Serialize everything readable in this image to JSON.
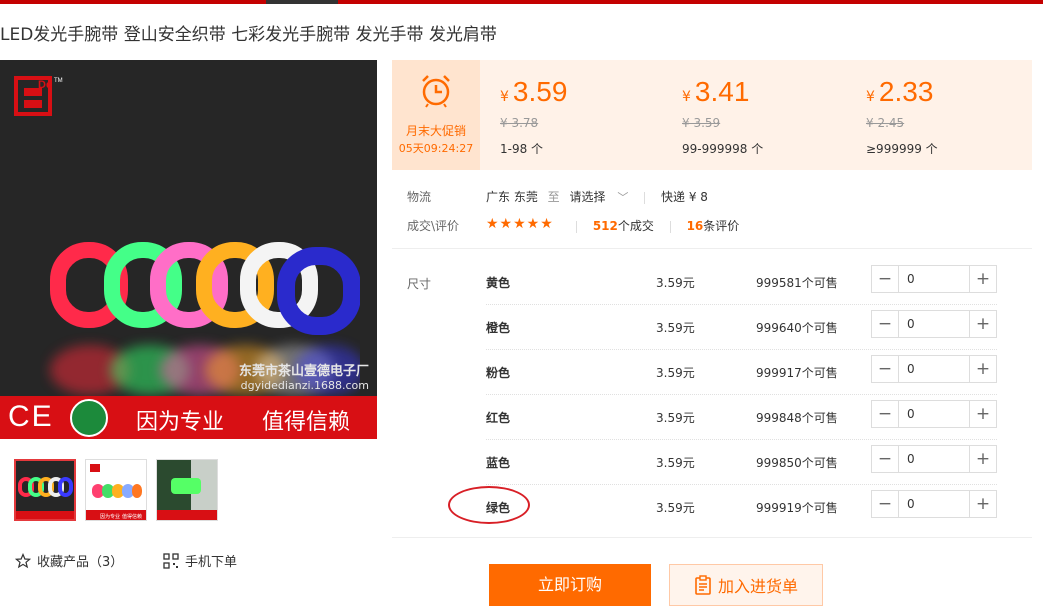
{
  "product": {
    "title": "LED发光手腕带 登山安全织带 七彩发光手腕带 发光手带 发光肩带"
  },
  "image": {
    "watermark_company": "东莞市茶山壹德电子厂",
    "watermark_url": "dgyidedianzi.1688.com",
    "ce_mark": "CE",
    "slogan_1": "因为专业",
    "slogan_2": "值得信赖",
    "logo_text": "De",
    "logo_tm": "TM",
    "thumbnail_slogan_1": "因为专业",
    "thumbnail_slogan_2": "值得信赖"
  },
  "actions": {
    "favorite": "收藏产品（3）",
    "mobile_order": "手机下单"
  },
  "promo": {
    "label": "月末大促销",
    "countdown": "05天09:24:27"
  },
  "tiers": [
    {
      "currency": "¥",
      "price": "3.59",
      "original": "¥ 3.78",
      "range": "1-98 个"
    },
    {
      "currency": "¥",
      "price": "3.41",
      "original": "¥ 3.59",
      "range": "99-999998 个"
    },
    {
      "currency": "¥",
      "price": "2.33",
      "original": "¥ 2.45",
      "range": "≥999999 个"
    }
  ],
  "logistics": {
    "label": "物流",
    "origin": "广东 东莞",
    "to": "至",
    "destination": "请选择",
    "express": "快递 ¥ 8"
  },
  "reviews": {
    "label": "成交\\评价",
    "stars": "★★★★★",
    "rating": 5,
    "deals_count": "512",
    "deals_suffix": "个成交",
    "review_count": "16",
    "review_suffix": "条评价"
  },
  "sku": {
    "label": "尺寸",
    "rows": [
      {
        "name": "黄色",
        "price": "3.59元",
        "stock": "999581个可售",
        "qty": "0"
      },
      {
        "name": "橙色",
        "price": "3.59元",
        "stock": "999640个可售",
        "qty": "0"
      },
      {
        "name": "粉色",
        "price": "3.59元",
        "stock": "999917个可售",
        "qty": "0"
      },
      {
        "name": "红色",
        "price": "3.59元",
        "stock": "999848个可售",
        "qty": "0"
      },
      {
        "name": "蓝色",
        "price": "3.59元",
        "stock": "999850个可售",
        "qty": "0"
      },
      {
        "name": "绿色",
        "price": "3.59元",
        "stock": "999919个可售",
        "qty": "0"
      }
    ]
  },
  "buttons": {
    "buy": "立即订购",
    "add_cart": "加入进货单"
  },
  "colors": {
    "accent": "#ff6a00",
    "brand_red": "#c40000",
    "annotation": "#d81f26"
  }
}
